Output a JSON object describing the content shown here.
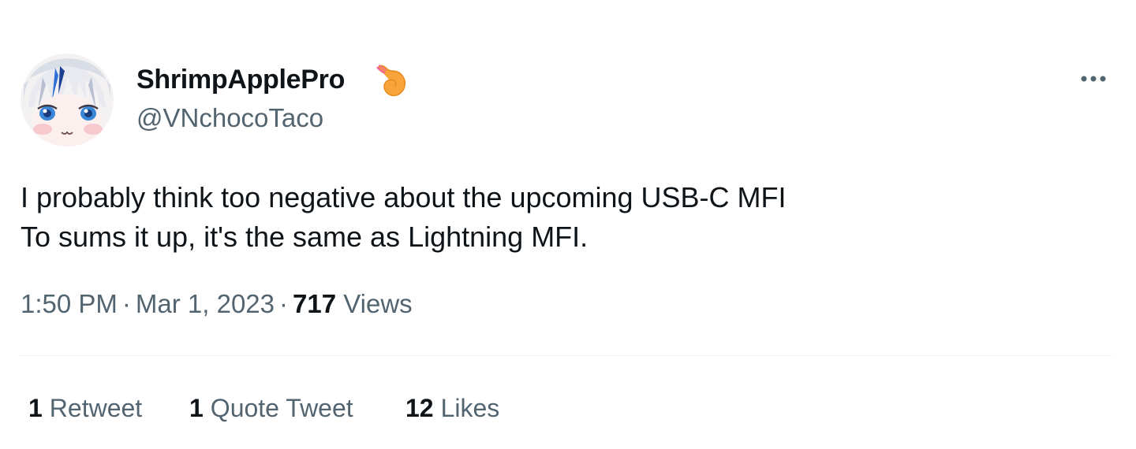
{
  "author": {
    "display_name": "ShrimpApplePro",
    "badge_icon": "shrimp-emoji-icon",
    "handle": "@VNchocoTaco",
    "avatar_icon": "anime-avatar-icon"
  },
  "more_icon": "more-horizontal-icon",
  "tweet": {
    "lines": [
      "I probably think too negative about the upcoming USB-C MFI",
      "To sums it up, it's the same as Lightning MFI."
    ]
  },
  "meta": {
    "time": "1:50 PM",
    "separator": "·",
    "date": "Mar 1, 2023",
    "views_count": "717",
    "views_label": "Views"
  },
  "stats": {
    "retweets": {
      "count": "1",
      "label": "Retweet"
    },
    "quotes": {
      "count": "1",
      "label": "Quote Tweet"
    },
    "likes": {
      "count": "12",
      "label": "Likes"
    }
  },
  "colors": {
    "text_primary": "#0f1419",
    "text_secondary": "#536471",
    "divider": "#eff3f4",
    "badge_orange": "#f7a43a"
  }
}
